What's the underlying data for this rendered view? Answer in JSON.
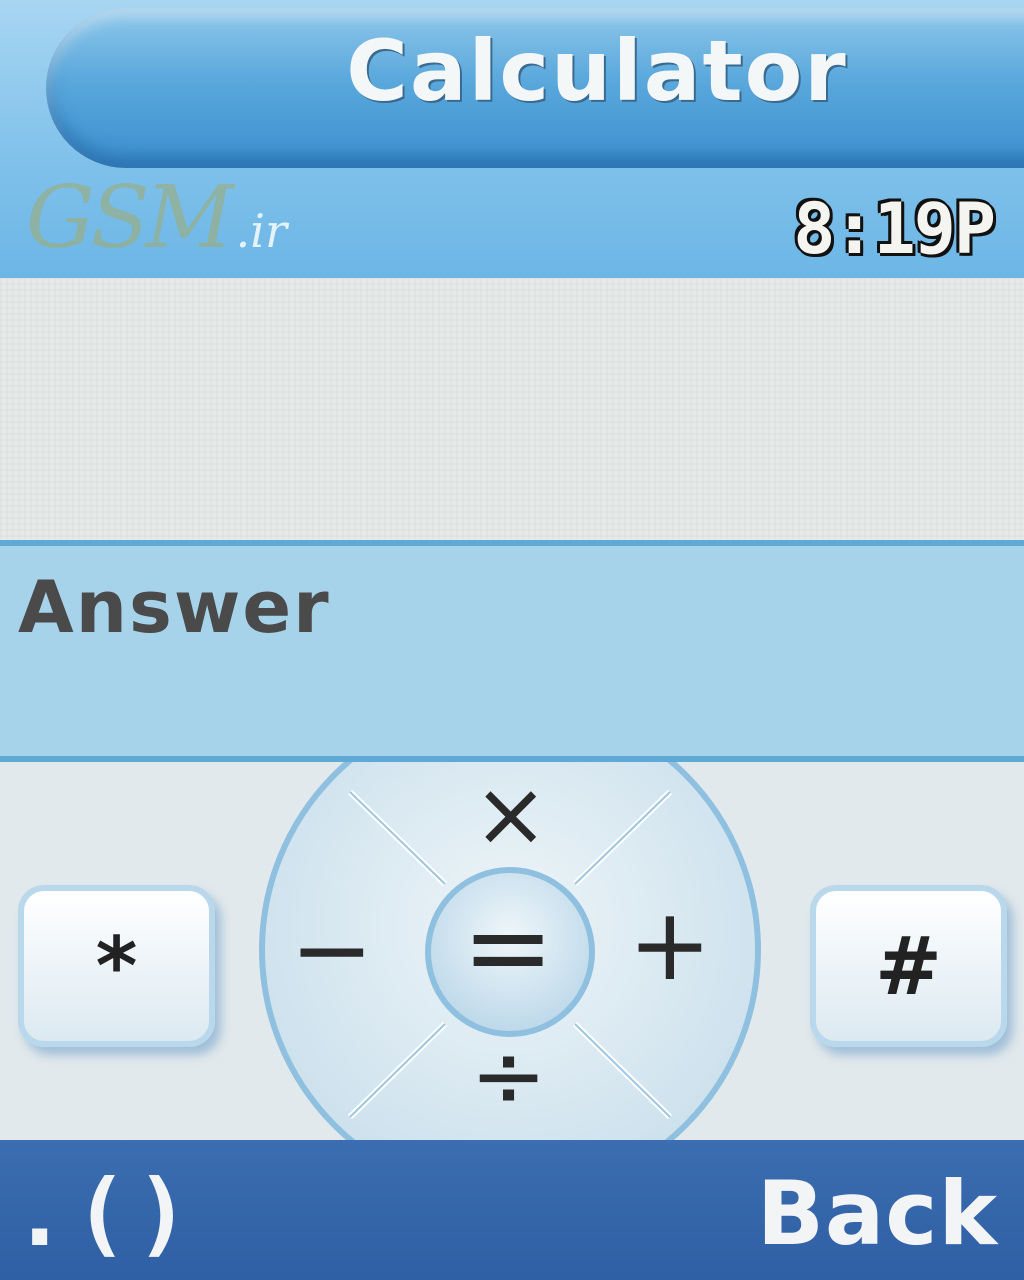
{
  "header": {
    "title": "Calculator",
    "logo_main": "GSM",
    "logo_suffix": ".ir",
    "clock": "8:19P"
  },
  "display": {
    "input_value": "",
    "answer_label": "Answer"
  },
  "keypad": {
    "star_key": "*",
    "hash_key": "#",
    "multiply": "×",
    "minus": "−",
    "plus": "+",
    "divide": "÷",
    "equals": "="
  },
  "softkeys": {
    "left": ".()",
    "right": "Back"
  },
  "colors": {
    "title_bar": "#5aa8dc",
    "answer_band": "#a7d3ea",
    "softkey_bar": "#2f5fa4"
  }
}
